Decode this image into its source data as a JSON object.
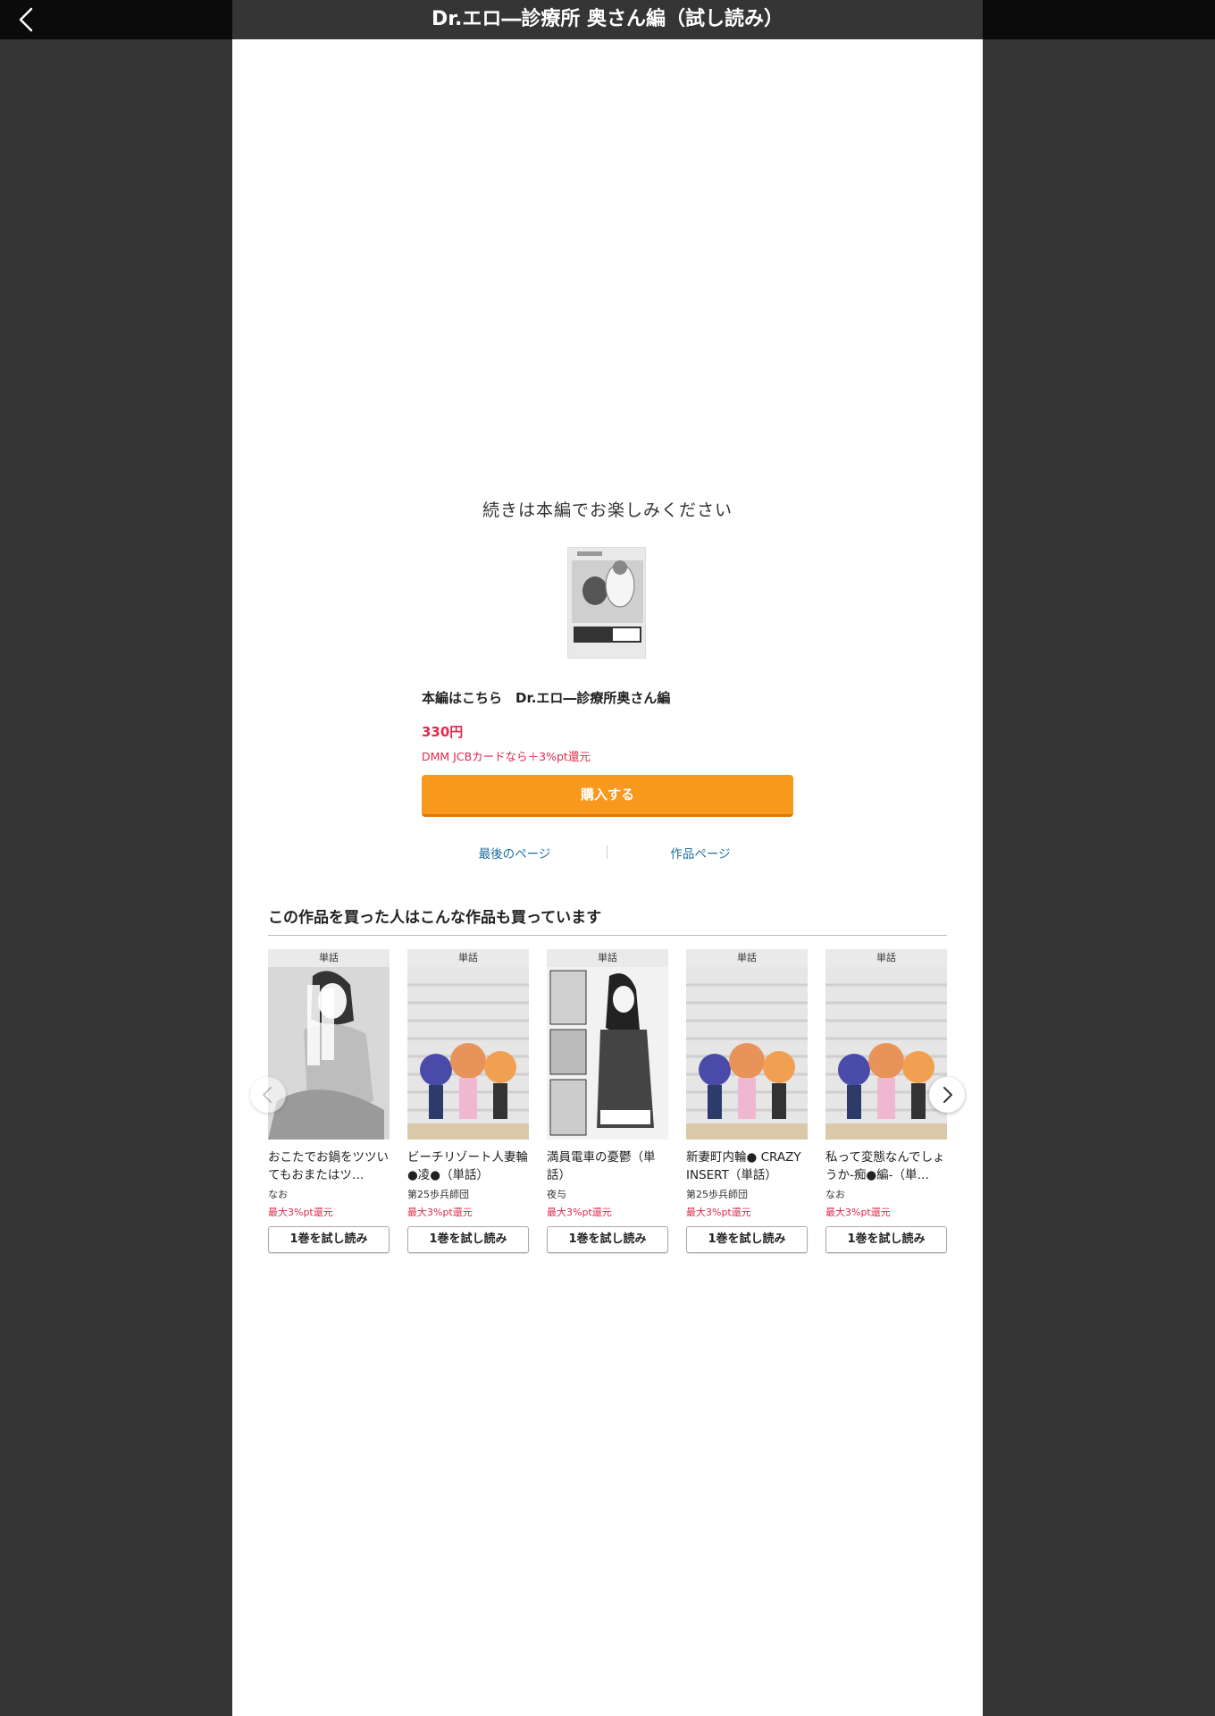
{
  "header": {
    "title": "Dr.エロ―診療所 奥さん編（試し読み）",
    "back_icon": "chevron-left-icon"
  },
  "end_screen": {
    "continue_message": "続きは本編でお楽しみください",
    "honpen_label": "本編はこちら　Dr.エロ―診療所奥さん編",
    "price": "330円",
    "campaign": "DMM JCBカードなら＋3%pt還元",
    "buy_label": "購入する",
    "last_page_link": "最後のページ",
    "work_page_link": "作品ページ",
    "colors": {
      "accent_orange": "#f8981d",
      "price_red": "#e0294b",
      "link_blue": "#1f6f9e"
    }
  },
  "recommendations": {
    "heading": "この作品を買った人はこんな作品も買っています",
    "items": [
      {
        "tag": "単話",
        "title": "おこたでお鍋をツツいてもおまたはツ…",
        "author": "なお",
        "points": "最大3%pt還元",
        "button": "1巻を試し読み"
      },
      {
        "tag": "単話",
        "title": "ビーチリゾート人妻輪●凌●（単話）",
        "author": "第25歩兵師団",
        "points": "最大3%pt還元",
        "button": "1巻を試し読み"
      },
      {
        "tag": "単話",
        "title": "満員電車の憂鬱（単話）",
        "author": "夜与",
        "points": "最大3%pt還元",
        "button": "1巻を試し読み"
      },
      {
        "tag": "単話",
        "title": "新妻町内輪● CRAZY INSERT（単話）",
        "author": "第25歩兵師団",
        "points": "最大3%pt還元",
        "button": "1巻を試し読み"
      },
      {
        "tag": "単話",
        "title": "私って変態なんでしょうか-痴●編-（単…",
        "author": "なお",
        "points": "最大3%pt還元",
        "button": "1巻を試し読み"
      }
    ]
  }
}
